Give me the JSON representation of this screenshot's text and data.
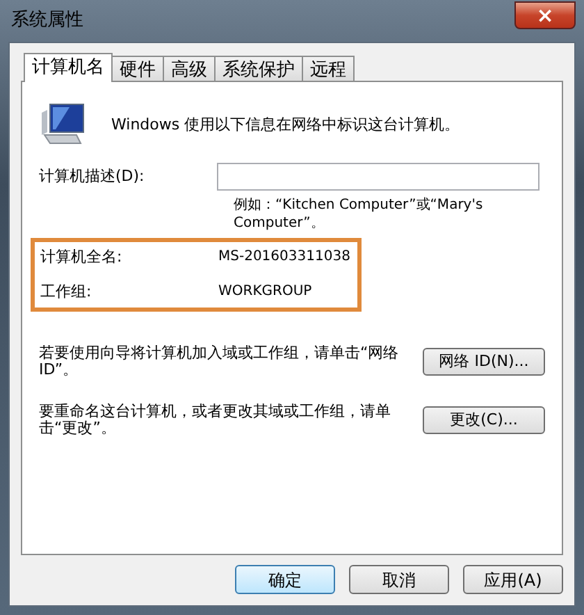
{
  "window": {
    "title": "系统属性",
    "close_label": "×"
  },
  "tabs": [
    {
      "label": "计算机名",
      "selected": true
    },
    {
      "label": "硬件",
      "selected": false
    },
    {
      "label": "高级",
      "selected": false
    },
    {
      "label": "系统保护",
      "selected": false
    },
    {
      "label": "远程",
      "selected": false
    }
  ],
  "intro": "Windows 使用以下信息在网络中标识这台计算机。",
  "description": {
    "label": "计算机描述(D):",
    "example": "例如：“Kitchen Computer”或“Mary's Computer”。"
  },
  "info": [
    {
      "label": "计算机全名:",
      "value": "MS-201603311038"
    },
    {
      "label": "工作组:",
      "value": "WORKGROUP"
    }
  ],
  "actions": [
    {
      "text": "若要使用向导将计算机加入域或工作组，请单击“网络 ID”。",
      "button": "网络 ID(N)..."
    },
    {
      "text": "要重命名这台计算机，或者更改其域或工作组，请单击“更改”。",
      "button": "更改(C)..."
    }
  ],
  "buttons": [
    {
      "label": "确定",
      "default": true
    },
    {
      "label": "取消",
      "default": false
    },
    {
      "label": "应用(A)",
      "default": false
    }
  ]
}
